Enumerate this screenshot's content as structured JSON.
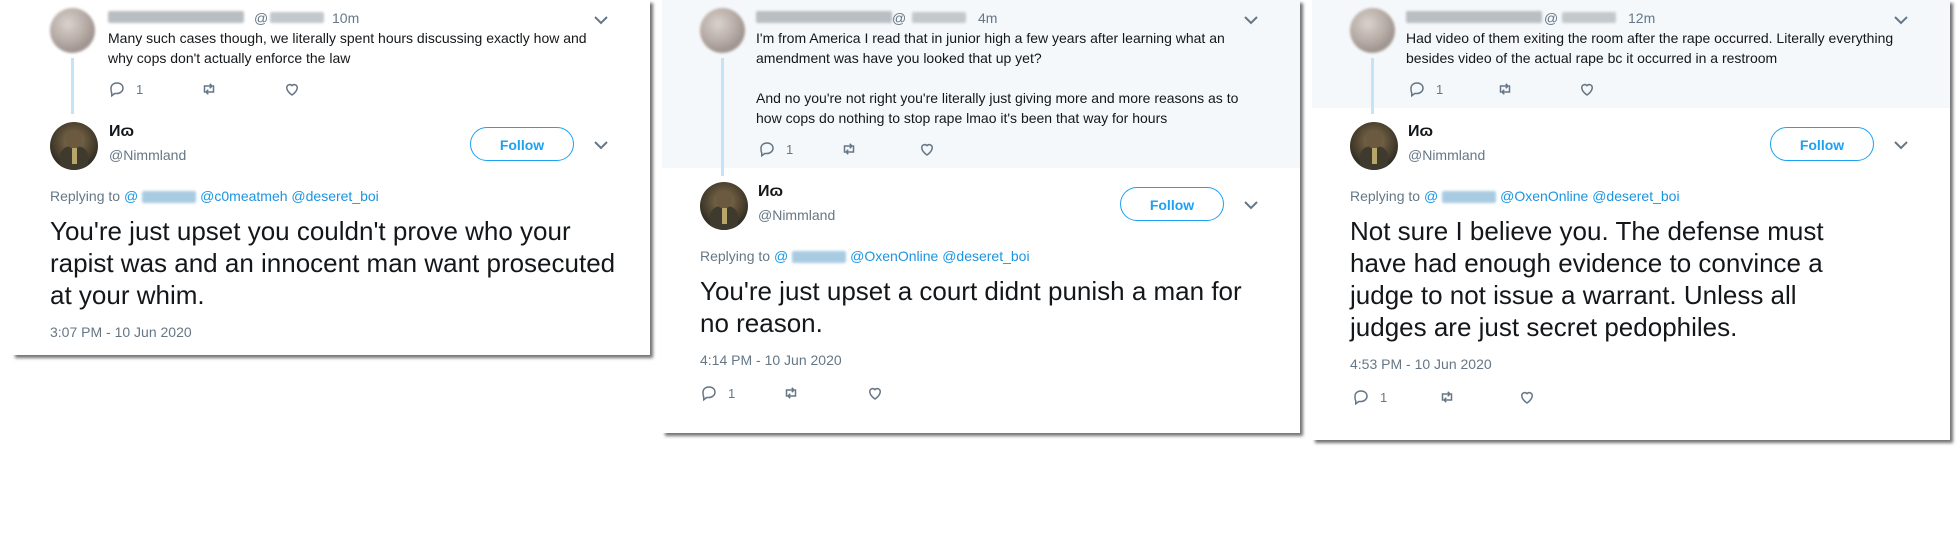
{
  "colors": {
    "accent": "#1da1f2",
    "mention": "#1b95e0",
    "muted": "#657786",
    "text": "#14171a"
  },
  "icons": [
    "reply-icon",
    "retweet-icon",
    "like-icon",
    "chevron-down-icon"
  ],
  "cards": [
    {
      "parent": {
        "at": "@",
        "time": "10m",
        "text": "Many such cases though, we literally spent hours discussing exactly how and\nwhy cops don't actually enforce the law",
        "reply_count": "1"
      },
      "tweet": {
        "name": "Иɷ",
        "handle": "@Nimmland",
        "follow_label": "Follow",
        "replying_prefix": "Replying to",
        "replying_at": "@",
        "mentions": [
          "@c0meatmeh",
          "@deseret_boi"
        ],
        "body": "You're just upset you couldn't prove who your rapist was and an innocent man want prosecuted at your whim.",
        "timestamp": "3:07 PM - 10 Jun 2020"
      }
    },
    {
      "parent": {
        "at": "@",
        "time": "4m",
        "text": "I'm from America I read that in junior high a few years after learning what an\namendment was have you looked that up yet?\n\nAnd no you're not right you're literally just giving more and more reasons as to\nhow cops do nothing to stop rape lmao it's been that way for hours",
        "reply_count": "1"
      },
      "tweet": {
        "name": "Иɷ",
        "handle": "@Nimmland",
        "follow_label": "Follow",
        "replying_prefix": "Replying to",
        "replying_at": "@",
        "mentions": [
          "@OxenOnline",
          "@deseret_boi"
        ],
        "body": "You're just upset a court didnt punish a man for no reason.",
        "timestamp": "4:14 PM - 10 Jun 2020",
        "reply_count": "1"
      }
    },
    {
      "parent": {
        "at": "@",
        "time": "12m",
        "text": "Had video of them exiting the room after the rape occurred. Literally everything\nbesides video of the actual rape bc it occurred in a restroom",
        "reply_count": "1"
      },
      "tweet": {
        "name": "Иɷ",
        "handle": "@Nimmland",
        "follow_label": "Follow",
        "replying_prefix": "Replying to",
        "replying_at": "@",
        "mentions": [
          "@OxenOnline",
          "@deseret_boi"
        ],
        "body": "Not sure I believe you. The defense must have had enough evidence to convince a judge to not issue a warrant. Unless all judges are just secret pedophiles.",
        "timestamp": "4:53 PM - 10 Jun 2020",
        "reply_count": "1"
      }
    }
  ]
}
